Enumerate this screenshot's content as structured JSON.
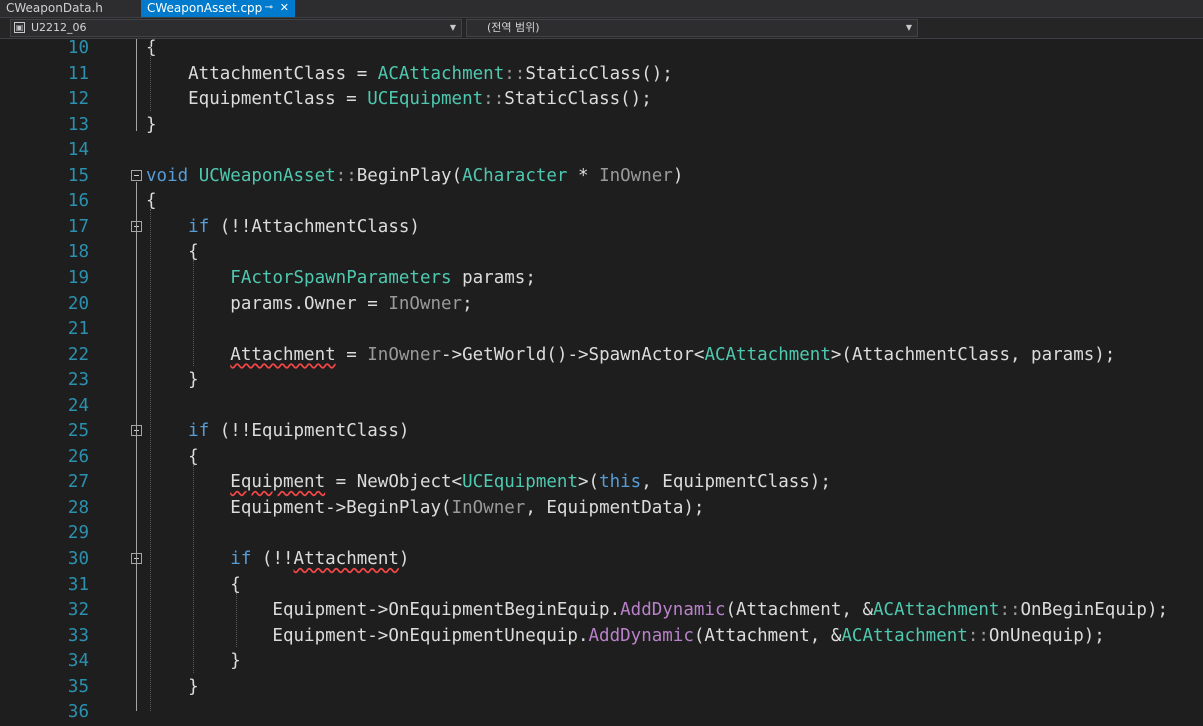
{
  "tabs": [
    {
      "label": "CWeaponData.h",
      "active": false
    },
    {
      "label": "CWeaponAsset.cpp",
      "active": true,
      "pin": "⊸",
      "close": "✕"
    }
  ],
  "navbar": {
    "project": "U2212_06",
    "scope": "(전역 범위)"
  },
  "lines": [
    {
      "num": "10",
      "fold": false,
      "segs": [
        [
          "{",
          ""
        ]
      ]
    },
    {
      "num": "11",
      "fold": false,
      "segs": [
        [
          "    AttachmentClass = ",
          ""
        ],
        [
          "ACAttachment",
          "ty"
        ],
        [
          "::",
          "pa"
        ],
        [
          "StaticClass();",
          ""
        ]
      ]
    },
    {
      "num": "12",
      "fold": false,
      "segs": [
        [
          "    EquipmentClass = ",
          ""
        ],
        [
          "UCEquipment",
          "ty"
        ],
        [
          "::",
          "pa"
        ],
        [
          "StaticClass();",
          ""
        ]
      ]
    },
    {
      "num": "13",
      "fold": false,
      "segs": [
        [
          "}",
          ""
        ]
      ]
    },
    {
      "num": "14",
      "fold": false,
      "segs": []
    },
    {
      "num": "15",
      "fold": true,
      "segs": [
        [
          "void",
          "kw"
        ],
        [
          " ",
          ""
        ],
        [
          "UCWeaponAsset",
          "ty"
        ],
        [
          "::",
          "pa"
        ],
        [
          "BeginPlay(",
          ""
        ],
        [
          "ACharacter",
          "ty"
        ],
        [
          " * ",
          ""
        ],
        [
          "InOwner",
          "pa"
        ],
        [
          ")",
          ""
        ]
      ]
    },
    {
      "num": "16",
      "fold": false,
      "segs": [
        [
          "{",
          ""
        ]
      ]
    },
    {
      "num": "17",
      "fold": true,
      "segs": [
        [
          "    ",
          ""
        ],
        [
          "if",
          "kw"
        ],
        [
          " (!!AttachmentClass)",
          ""
        ]
      ]
    },
    {
      "num": "18",
      "fold": false,
      "segs": [
        [
          "    {",
          ""
        ]
      ]
    },
    {
      "num": "19",
      "fold": false,
      "segs": [
        [
          "        ",
          ""
        ],
        [
          "FActorSpawnParameters",
          "ty"
        ],
        [
          " params;",
          ""
        ]
      ]
    },
    {
      "num": "20",
      "fold": false,
      "segs": [
        [
          "        params.Owner = ",
          ""
        ],
        [
          "InOwner",
          "pa"
        ],
        [
          ";",
          ""
        ]
      ]
    },
    {
      "num": "21",
      "fold": false,
      "segs": []
    },
    {
      "num": "22",
      "fold": false,
      "segs": [
        [
          "        ",
          ""
        ],
        [
          "Attachment",
          "sq"
        ],
        [
          " = ",
          ""
        ],
        [
          "InOwner",
          "pa"
        ],
        [
          "->GetWorld()->SpawnActor<",
          ""
        ],
        [
          "ACAttachment",
          "ty"
        ],
        [
          ">(AttachmentClass, params);",
          ""
        ]
      ]
    },
    {
      "num": "23",
      "fold": false,
      "segs": [
        [
          "    }",
          ""
        ]
      ]
    },
    {
      "num": "24",
      "fold": false,
      "segs": []
    },
    {
      "num": "25",
      "fold": true,
      "segs": [
        [
          "    ",
          ""
        ],
        [
          "if",
          "kw"
        ],
        [
          " (!!EquipmentClass)",
          ""
        ]
      ]
    },
    {
      "num": "26",
      "fold": false,
      "segs": [
        [
          "    {",
          ""
        ]
      ]
    },
    {
      "num": "27",
      "fold": false,
      "segs": [
        [
          "        ",
          ""
        ],
        [
          "Equipment",
          "sq"
        ],
        [
          " = NewObject<",
          ""
        ],
        [
          "UCEquipment",
          "ty"
        ],
        [
          ">(",
          ""
        ],
        [
          "this",
          "kw"
        ],
        [
          ", EquipmentClass);",
          ""
        ]
      ]
    },
    {
      "num": "28",
      "fold": false,
      "segs": [
        [
          "        Equipment->BeginPlay(",
          ""
        ],
        [
          "InOwner",
          "pa"
        ],
        [
          ", EquipmentData);",
          ""
        ]
      ]
    },
    {
      "num": "29",
      "fold": false,
      "segs": []
    },
    {
      "num": "30",
      "fold": true,
      "segs": [
        [
          "        ",
          ""
        ],
        [
          "if",
          "kw"
        ],
        [
          " (!!",
          ""
        ],
        [
          "Attachment",
          "sq"
        ],
        [
          ")",
          ""
        ]
      ]
    },
    {
      "num": "31",
      "fold": false,
      "segs": [
        [
          "        {",
          ""
        ]
      ]
    },
    {
      "num": "32",
      "fold": false,
      "segs": [
        [
          "            Equipment->OnEquipmentBeginEquip.",
          ""
        ],
        [
          "AddDynamic",
          "mc"
        ],
        [
          "(Attachment, &",
          ""
        ],
        [
          "ACAttachment",
          "ty"
        ],
        [
          "::",
          "pa"
        ],
        [
          "OnBeginEquip);",
          ""
        ]
      ]
    },
    {
      "num": "33",
      "fold": false,
      "segs": [
        [
          "            Equipment->OnEquipmentUnequip.",
          ""
        ],
        [
          "AddDynamic",
          "mc"
        ],
        [
          "(Attachment, &",
          ""
        ],
        [
          "ACAttachment",
          "ty"
        ],
        [
          "::",
          "pa"
        ],
        [
          "OnUnequip);",
          ""
        ]
      ]
    },
    {
      "num": "34",
      "fold": false,
      "segs": [
        [
          "        }",
          ""
        ]
      ]
    },
    {
      "num": "35",
      "fold": false,
      "segs": [
        [
          "    }",
          ""
        ]
      ]
    },
    {
      "num": "36",
      "fold": false,
      "segs": []
    }
  ]
}
